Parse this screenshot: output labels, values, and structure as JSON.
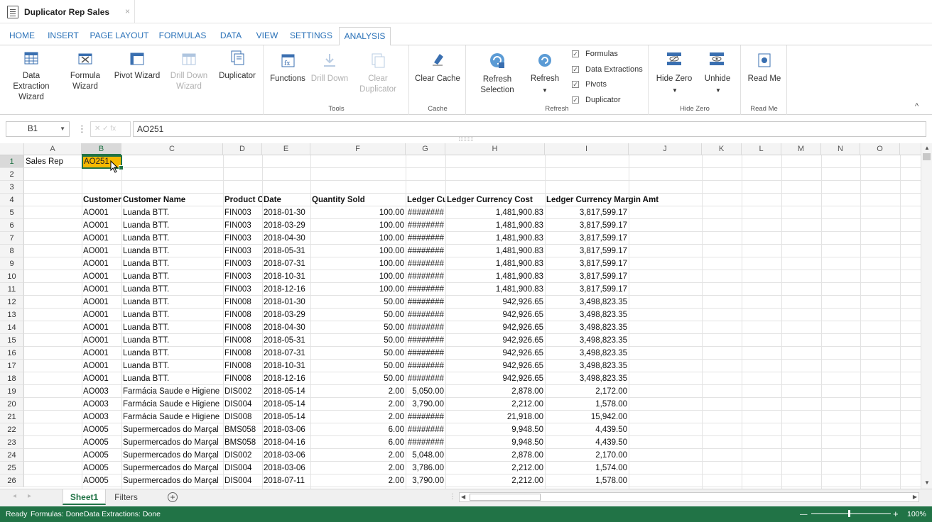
{
  "titlebar": {
    "doc_title": "Duplicator Rep Sales",
    "close": "×"
  },
  "ribbon_tabs": [
    "HOME",
    "INSERT",
    "PAGE LAYOUT",
    "FORMULAS",
    "DATA",
    "VIEW",
    "SETTINGS",
    "ANALYSIS"
  ],
  "ribbon": {
    "data_extraction_wizard": "Data Extraction Wizard",
    "formula_wizard": "Formula Wizard",
    "pivot_wizard": "Pivot Wizard",
    "drill_down_wizard": "Drill Down Wizard",
    "duplicator": "Duplicator",
    "functions": "Functions",
    "drill_down": "Drill Down",
    "clear_duplicator": "Clear Duplicator",
    "tools_label": "Tools",
    "clear_cache": "Clear Cache",
    "cache_label": "Cache",
    "refresh_selection": "Refresh Selection",
    "refresh": "Refresh",
    "chk_formulas": "Formulas",
    "chk_data_extractions": "Data Extractions",
    "chk_pivots": "Pivots",
    "chk_duplicator": "Duplicator",
    "refresh_label": "Refresh",
    "hide_zero": "Hide Zero",
    "unhide": "Unhide",
    "hide_zero_label": "Hide Zero",
    "read_me": "Read Me",
    "read_me_label": "Read Me",
    "collapse": "^"
  },
  "formula_bar": {
    "name_box": "B1",
    "formula": "AO251",
    "fx": "✕ ✓ fx"
  },
  "columns": [
    "A",
    "B",
    "C",
    "D",
    "E",
    "F",
    "G",
    "H",
    "I",
    "J",
    "K",
    "L",
    "M",
    "N",
    "O"
  ],
  "row_numbers": [
    "1",
    "2",
    "3",
    "4",
    "5",
    "6",
    "7",
    "8",
    "9",
    "10",
    "11",
    "12",
    "13",
    "14",
    "15",
    "16",
    "17",
    "18",
    "19",
    "20",
    "21",
    "22",
    "23",
    "24",
    "25",
    "26"
  ],
  "cells": {
    "a1": "Sales Rep",
    "b1": "AO251"
  },
  "table_header": [
    "Customer",
    "Customer Name",
    "Product C",
    "Date",
    "Quantity Sold",
    "Ledger Cu",
    "Ledger Currency Cost",
    "Ledger Currency Margin Amt"
  ],
  "table_rows": [
    [
      "AO001",
      "Luanda BTT.",
      "FIN003",
      "2018-01-30",
      "100.00",
      "########",
      "1,481,900.83",
      "3,817,599.17"
    ],
    [
      "AO001",
      "Luanda BTT.",
      "FIN003",
      "2018-03-29",
      "100.00",
      "########",
      "1,481,900.83",
      "3,817,599.17"
    ],
    [
      "AO001",
      "Luanda BTT.",
      "FIN003",
      "2018-04-30",
      "100.00",
      "########",
      "1,481,900.83",
      "3,817,599.17"
    ],
    [
      "AO001",
      "Luanda BTT.",
      "FIN003",
      "2018-05-31",
      "100.00",
      "########",
      "1,481,900.83",
      "3,817,599.17"
    ],
    [
      "AO001",
      "Luanda BTT.",
      "FIN003",
      "2018-07-31",
      "100.00",
      "########",
      "1,481,900.83",
      "3,817,599.17"
    ],
    [
      "AO001",
      "Luanda BTT.",
      "FIN003",
      "2018-10-31",
      "100.00",
      "########",
      "1,481,900.83",
      "3,817,599.17"
    ],
    [
      "AO001",
      "Luanda BTT.",
      "FIN003",
      "2018-12-16",
      "100.00",
      "########",
      "1,481,900.83",
      "3,817,599.17"
    ],
    [
      "AO001",
      "Luanda BTT.",
      "FIN008",
      "2018-01-30",
      "50.00",
      "########",
      "942,926.65",
      "3,498,823.35"
    ],
    [
      "AO001",
      "Luanda BTT.",
      "FIN008",
      "2018-03-29",
      "50.00",
      "########",
      "942,926.65",
      "3,498,823.35"
    ],
    [
      "AO001",
      "Luanda BTT.",
      "FIN008",
      "2018-04-30",
      "50.00",
      "########",
      "942,926.65",
      "3,498,823.35"
    ],
    [
      "AO001",
      "Luanda BTT.",
      "FIN008",
      "2018-05-31",
      "50.00",
      "########",
      "942,926.65",
      "3,498,823.35"
    ],
    [
      "AO001",
      "Luanda BTT.",
      "FIN008",
      "2018-07-31",
      "50.00",
      "########",
      "942,926.65",
      "3,498,823.35"
    ],
    [
      "AO001",
      "Luanda BTT.",
      "FIN008",
      "2018-10-31",
      "50.00",
      "########",
      "942,926.65",
      "3,498,823.35"
    ],
    [
      "AO001",
      "Luanda BTT.",
      "FIN008",
      "2018-12-16",
      "50.00",
      "########",
      "942,926.65",
      "3,498,823.35"
    ],
    [
      "AO003",
      "Farmácia Saude e Higiene",
      "DIS002",
      "2018-05-14",
      "2.00",
      "5,050.00",
      "2,878.00",
      "2,172.00"
    ],
    [
      "AO003",
      "Farmácia Saude e Higiene",
      "DIS004",
      "2018-05-14",
      "2.00",
      "3,790.00",
      "2,212.00",
      "1,578.00"
    ],
    [
      "AO003",
      "Farmácia Saude e Higiene",
      "DIS008",
      "2018-05-14",
      "2.00",
      "########",
      "21,918.00",
      "15,942.00"
    ],
    [
      "AO005",
      "Supermercados do Marçal",
      "BMS058",
      "2018-03-06",
      "6.00",
      "########",
      "9,948.50",
      "4,439.50"
    ],
    [
      "AO005",
      "Supermercados do Marçal",
      "BMS058",
      "2018-04-16",
      "6.00",
      "########",
      "9,948.50",
      "4,439.50"
    ],
    [
      "AO005",
      "Supermercados do Marçal",
      "DIS002",
      "2018-03-06",
      "2.00",
      "5,048.00",
      "2,878.00",
      "2,170.00"
    ],
    [
      "AO005",
      "Supermercados do Marçal",
      "DIS004",
      "2018-03-06",
      "2.00",
      "3,786.00",
      "2,212.00",
      "1,574.00"
    ],
    [
      "AO005",
      "Supermercados do Marçal",
      "DIS004",
      "2018-07-11",
      "2.00",
      "3,790.00",
      "2,212.00",
      "1,578.00"
    ]
  ],
  "sheets": {
    "active": "Sheet1",
    "other": "Filters",
    "add": "+"
  },
  "status": {
    "ready": "Ready",
    "formulas": "Formulas: Done",
    "extractions": "Data Extractions: Done",
    "zoom": "100%",
    "minus": "—",
    "plus": "+"
  }
}
